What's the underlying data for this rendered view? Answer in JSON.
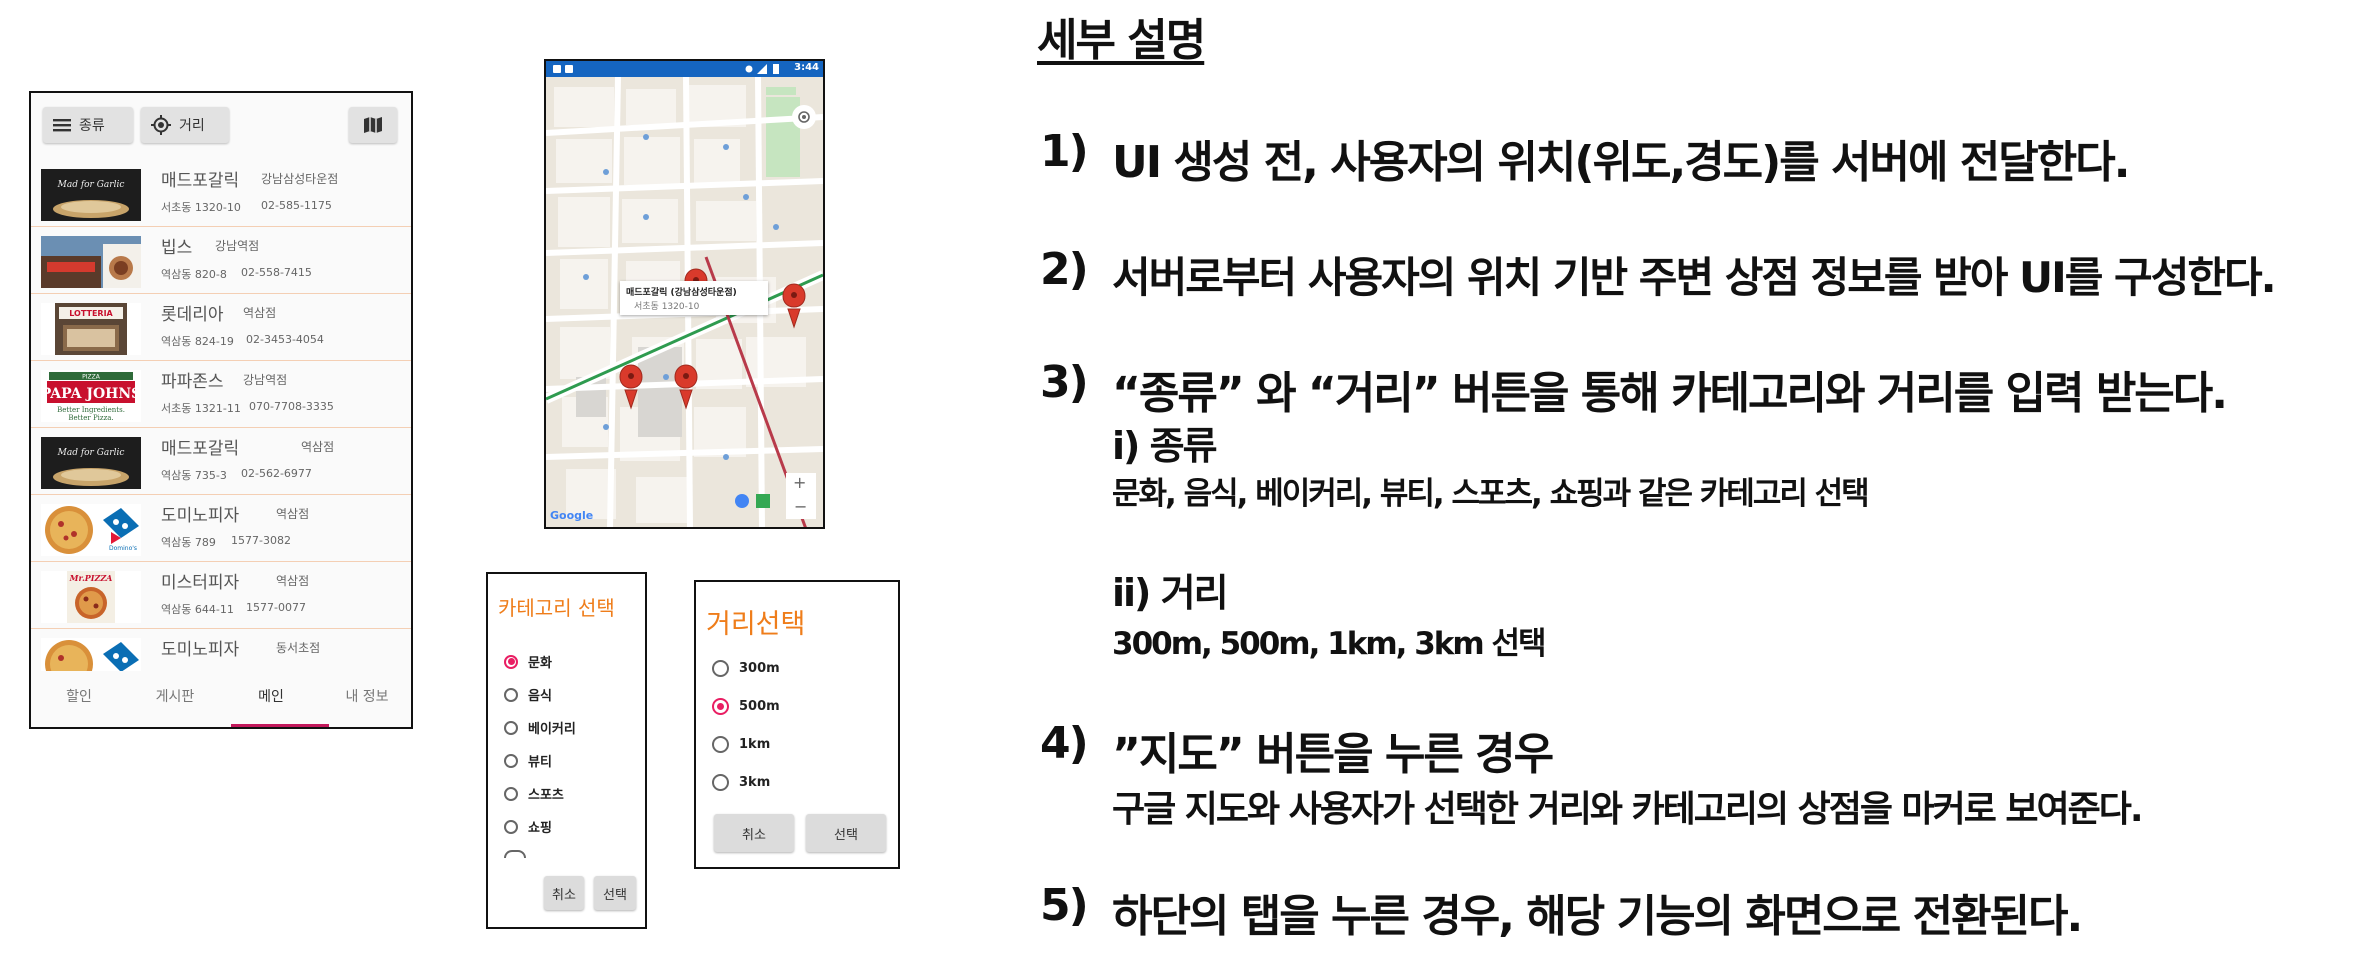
{
  "list_screen": {
    "toolbar": {
      "category_label": "종류",
      "distance_label": "거리",
      "map_icon": "map-icon"
    },
    "stores": [
      {
        "name": "매드포갈릭",
        "branch": "강남삼성타운점",
        "address": "서초동 1320-10",
        "phone": "02-585-1175",
        "thumb": "madforgarlic"
      },
      {
        "name": "빕스",
        "branch": "강남역점",
        "address": "역삼동 820-8",
        "phone": "02-558-7415",
        "thumb": "vips"
      },
      {
        "name": "롯데리아",
        "branch": "역삼점",
        "address": "역삼동 824-19",
        "phone": "02-3453-4054",
        "thumb": "lotteria"
      },
      {
        "name": "파파존스",
        "branch": "강남역점",
        "address": "서초동 1321-11",
        "phone": "070-7708-3335",
        "thumb": "papajohns"
      },
      {
        "name": "매드포갈릭",
        "branch": "역삼점",
        "address": "역삼동 735-3",
        "phone": "02-562-6977",
        "thumb": "madforgarlic"
      },
      {
        "name": "도미노피자",
        "branch": "역삼점",
        "address": "역삼동 789",
        "phone": "1577-3082",
        "thumb": "dominos"
      },
      {
        "name": "미스터피자",
        "branch": "역삼점",
        "address": "역삼동 644-11",
        "phone": "1577-0077",
        "thumb": "mrpizza"
      },
      {
        "name": "도미노피자",
        "branch": "동서초점",
        "address": "",
        "phone": "",
        "thumb": "dominos"
      }
    ],
    "tabs": [
      {
        "label": "할인"
      },
      {
        "label": "게시판"
      },
      {
        "label": "메인",
        "active": true
      },
      {
        "label": "내 정보"
      }
    ]
  },
  "map_screen": {
    "status_time": "3:44",
    "info_window": {
      "title": "매드포갈릭 (강남삼성타운점)",
      "address": "서초동 1320-10"
    },
    "google_logo": "Google",
    "zoom_in": "+",
    "zoom_out": "−"
  },
  "category_dialog": {
    "title": "카테고리 선택",
    "options": [
      {
        "label": "문화",
        "selected": true
      },
      {
        "label": "음식",
        "selected": false
      },
      {
        "label": "베이커리",
        "selected": false
      },
      {
        "label": "뷰티",
        "selected": false
      },
      {
        "label": "스포츠",
        "selected": false
      },
      {
        "label": "쇼핑",
        "selected": false
      }
    ],
    "cancel_label": "취소",
    "ok_label": "선택"
  },
  "distance_dialog": {
    "title": "거리선택",
    "options": [
      {
        "label": "300m",
        "selected": false
      },
      {
        "label": "500m",
        "selected": true
      },
      {
        "label": "1km",
        "selected": false
      },
      {
        "label": "3km",
        "selected": false
      }
    ],
    "cancel_label": "취소",
    "ok_label": "선택"
  },
  "description": {
    "heading": "세부 설명",
    "items": [
      {
        "num": "1)",
        "text": "UI 생성 전, 사용자의 위치(위도,경도)를 서버에 전달한다."
      },
      {
        "num": "2)",
        "text": "서버로부터 사용자의 위치 기반 주변 상점 정보를 받아 UI를 구성한다."
      },
      {
        "num": "3)",
        "text": "“종류” 와 “거리” 버튼을 통해 카테고리와 거리를 입력 받는다."
      },
      {
        "num": "4)",
        "text": "”지도” 버튼을 누른 경우"
      },
      {
        "num": "5)",
        "text": "하단의 탭을 누른 경우, 해당 기능의 화면으로 전환된다."
      }
    ],
    "sub_i_title": "i) 종류",
    "sub_i_desc": "문화, 음식, 베이커리, 뷰티, 스포츠, 쇼핑과 같은 카테고리 선택",
    "sub_ii_title": "ii) 거리",
    "sub_ii_desc": "300m, 500m, 1km, 3km 선택",
    "item4_desc": "구글 지도와 사용자가 선택한 거리와 카테고리의 상점을 마커로 보여준다."
  },
  "colors": {
    "accent_orange": "#ef7d1a",
    "radio_pink": "#e91e63",
    "tab_indicator": "#c2185b",
    "row_divider": "#f4cfb4",
    "status_blue": "#1565c0"
  }
}
